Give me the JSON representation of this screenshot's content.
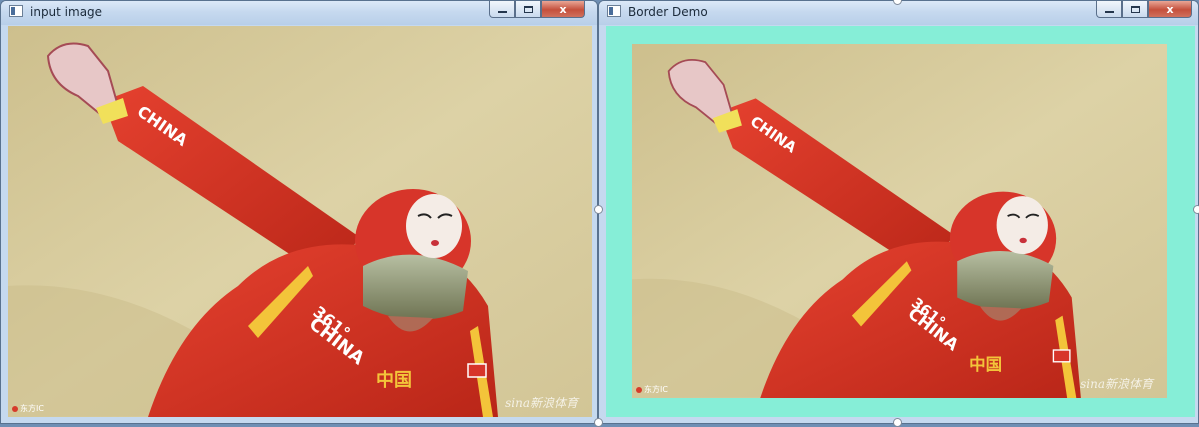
{
  "windows": [
    {
      "title": "input image",
      "watermark": "sina新浪体育",
      "credit": "东方IC"
    },
    {
      "title": "Border Demo",
      "watermark": "sina新浪体育",
      "credit": "东方IC",
      "border_color": "#86eed7"
    }
  ],
  "caption_buttons": {
    "min": "",
    "max": "",
    "close": "x"
  },
  "photo": {
    "jersey_text": "CHINA",
    "sleeve_text": "CHINA",
    "sponsor": "361°",
    "emblem": "中国"
  },
  "colors": {
    "titlebar": "#c6d9ef",
    "suit": "#d93a2b",
    "background_wall": "#d8cc9a",
    "close_button": "#c5503c"
  }
}
